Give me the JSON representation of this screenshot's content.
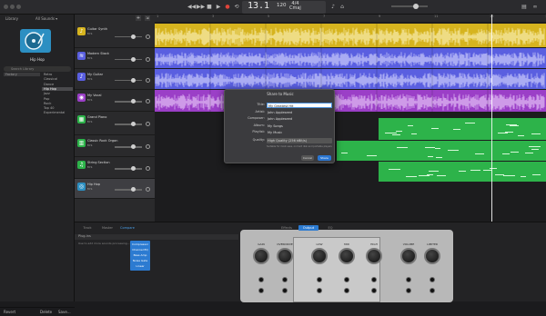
{
  "toolbar": {
    "position": "13.1",
    "tempo_value": "120",
    "tempo_label": "bpm",
    "time_sig": "4/4",
    "key": "Cmaj"
  },
  "library": {
    "title": "Library",
    "sounds": "All Sounds ▾",
    "patch_name": "Hip Hop",
    "search_placeholder": "Search Library",
    "category": "Factory",
    "items": [
      "Retro",
      "Classical",
      "Dance",
      "Hip Hop",
      "Jazz",
      "Pop",
      "Rock",
      "Top 40",
      "Experimental"
    ],
    "selected": "Hip Hop",
    "footer": {
      "revert": "Revert",
      "delete": "Delete",
      "save": "Save..."
    }
  },
  "tracks": [
    {
      "name": "Guitar Synth",
      "color": "#d6b41f"
    },
    {
      "name": "Modern Stack",
      "color": "#5a5fe0"
    },
    {
      "name": "My Guitar",
      "color": "#5a5fe0"
    },
    {
      "name": "My Vocal",
      "color": "#9b3fc7"
    },
    {
      "name": "Grand Piano",
      "color": "#2db34a"
    },
    {
      "name": "Classic Rock Organ",
      "color": "#2db34a"
    },
    {
      "name": "String Section",
      "color": "#2db34a"
    },
    {
      "name": "Hip Hop",
      "color": "#2c8fc2"
    }
  ],
  "track_ms": "M S",
  "regions": {
    "guitar": "Audio 1",
    "stack": "Audio 2",
    "myguitar": "Audio 3",
    "vocal": "My Vocal"
  },
  "ruler": [
    "1",
    "3",
    "5",
    "7",
    "9",
    "11",
    "13",
    "15"
  ],
  "dialog": {
    "title": "Share to Music",
    "fields": [
      {
        "label": "Title:",
        "value": "My Greatest Hit"
      },
      {
        "label": "Artist:",
        "value": "John Appleseed"
      },
      {
        "label": "Composer:",
        "value": "John Appleseed"
      },
      {
        "label": "Album:",
        "value": "My Songs"
      },
      {
        "label": "Playlist:",
        "value": "My Music"
      }
    ],
    "quality_label": "Quality:",
    "quality_value": "High Quality (256 kBit/s)",
    "info": "Suitable for most uses, on hard disk and portable players",
    "cancel": "Cancel",
    "share": "Share"
  },
  "bottom": {
    "tabs_left": [
      "Track",
      "Master",
      "Compare"
    ],
    "tabs_mid": [
      "Effects",
      "Output",
      "EQ"
    ],
    "plugin_header": "Plug-ins",
    "plugin_hint": "Use to add more sounds processing...",
    "plugins": [
      "Compressor",
      "Channel EQ",
      "Bass Amp",
      "Noise Gate",
      "Linear"
    ],
    "amp_labels": [
      "GAIN",
      "OVERDRIVE",
      "LOW",
      "MID",
      "HIGH",
      "VOLUME",
      "LIMITER"
    ]
  }
}
